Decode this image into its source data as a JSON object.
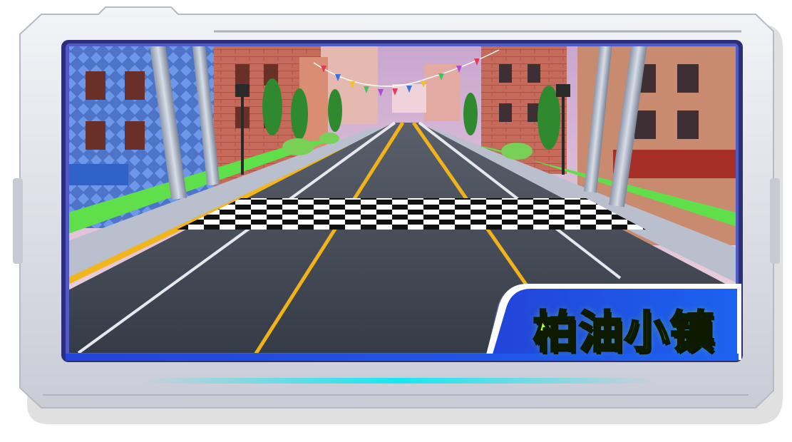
{
  "level_card": {
    "title": "柏油小镇",
    "title_color": "#b6ff2a",
    "frame_color": "#dcdfe6",
    "accent_color": "#1f55e8",
    "glow_color": "#19e6f0"
  },
  "scene": {
    "description_icon": "race-track-finish-line-icon",
    "sky_color": "#d9b7d3",
    "road_color": "#3f4651",
    "lane_line_color": "#f1b21a",
    "grass_color": "#5fe04a"
  }
}
